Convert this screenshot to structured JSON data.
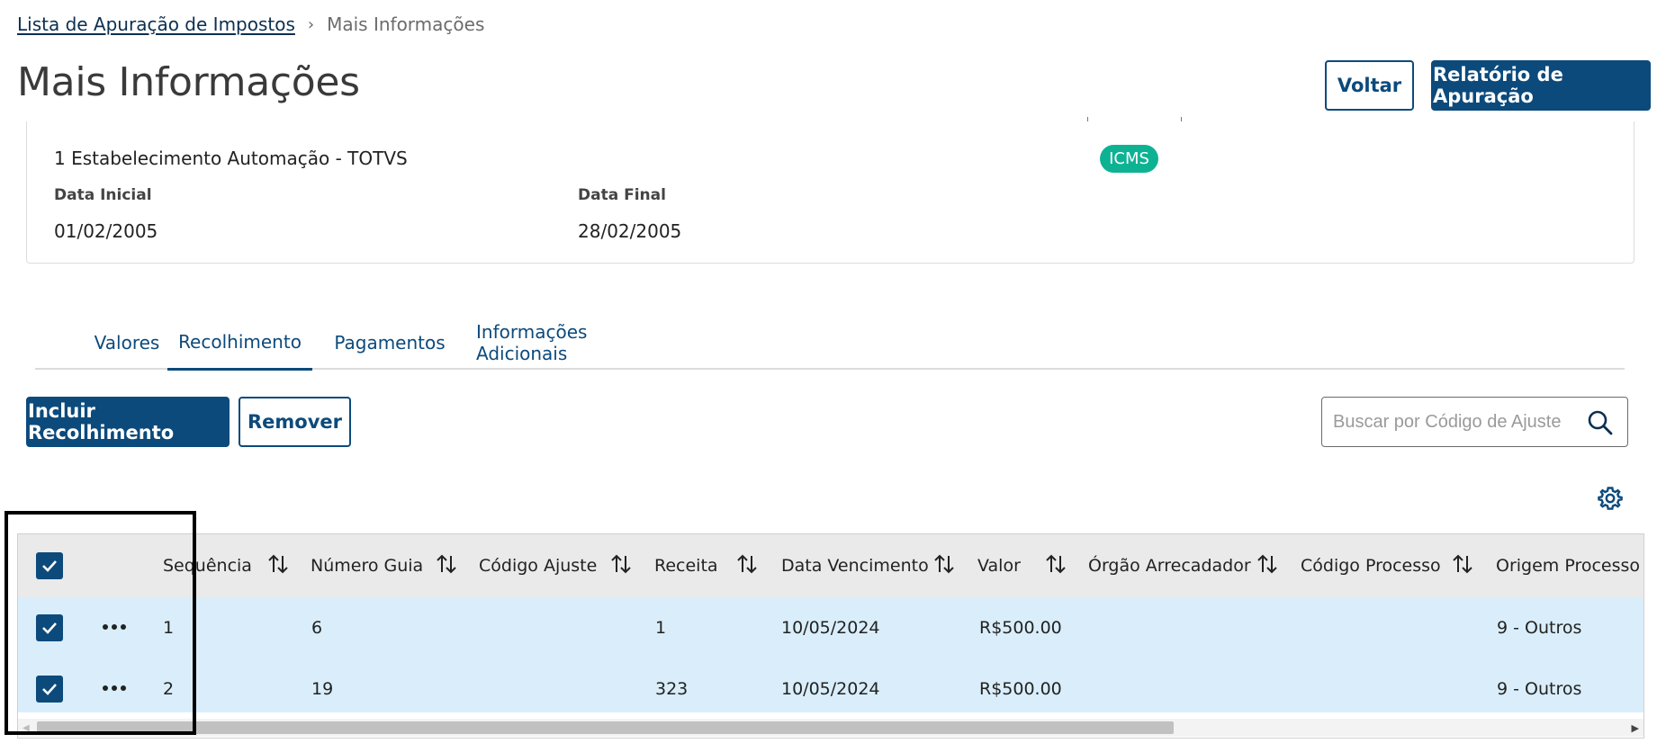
{
  "breadcrumb": {
    "parent": "Lista de Apuração de Impostos",
    "separator": "›",
    "current": "Mais Informações"
  },
  "page": {
    "title": "Mais Informações"
  },
  "header_actions": {
    "voltar": "Voltar",
    "relatorio": "Relatório de Apuração"
  },
  "info": {
    "estabelecimento": "1 Estabelecimento Automação - TOTVS",
    "imposto_badge": "ICMS",
    "data_inicial_label": "Data Inicial",
    "data_inicial": "01/02/2005",
    "data_final_label": "Data Final",
    "data_final": "28/02/2005"
  },
  "tabs": [
    {
      "label": "Valores"
    },
    {
      "label": "Recolhimento",
      "active": true
    },
    {
      "label": "Pagamentos"
    },
    {
      "label": "Informações Adicionais"
    }
  ],
  "toolbar": {
    "incluir": "Incluir Recolhimento",
    "remover": "Remover"
  },
  "search": {
    "placeholder": "Buscar por Código de Ajuste"
  },
  "table": {
    "columns": [
      "Sequência",
      "Número Guia",
      "Código Ajuste",
      "Receita",
      "Data Vencimento",
      "Valor",
      "Órgão Arrecadador",
      "Código Processo",
      "Origem Processo"
    ],
    "rows": [
      {
        "sequencia": "1",
        "numero_guia": "6",
        "codigo_ajuste": "",
        "receita": "1",
        "data_vencimento": "10/05/2024",
        "valor": "R$500.00",
        "orgao": "",
        "codigo_processo": "",
        "origem_processo": "9 - Outros"
      },
      {
        "sequencia": "2",
        "numero_guia": "19",
        "codigo_ajuste": "",
        "receita": "323",
        "data_vencimento": "10/05/2024",
        "valor": "R$500.00",
        "orgao": "",
        "codigo_processo": "",
        "origem_processo": "9 - Outros"
      }
    ]
  },
  "colors": {
    "primary": "#0c4a7c",
    "badge": "#0db293",
    "row_selected": "#d9eefa",
    "header_bg": "#eaeaea"
  }
}
